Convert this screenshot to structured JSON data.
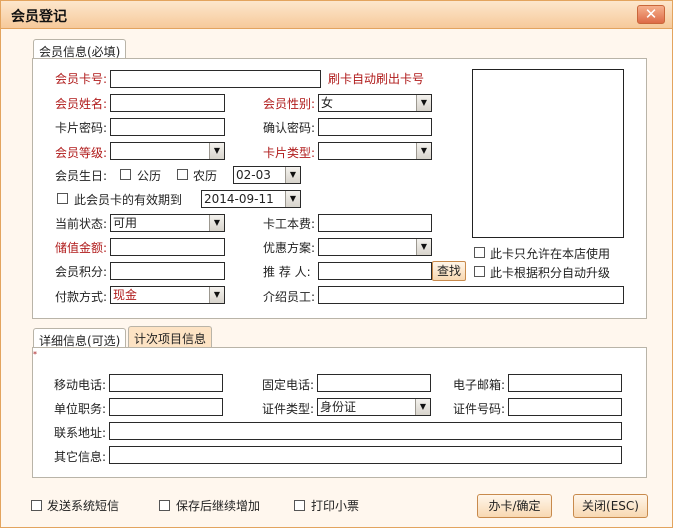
{
  "window": {
    "title": "会员登记",
    "close_icon": "close-icon"
  },
  "tabs": {
    "member_info": "会员信息(必填)",
    "detail": "详细信息(可选)",
    "count_items": "计次项目信息"
  },
  "labels": {
    "card_no": "会员卡号:",
    "name": "会员姓名:",
    "gender": "会员性别:",
    "card_pwd": "卡片密码:",
    "confirm_pwd": "确认密码:",
    "level": "会员等级:",
    "card_type": "卡片类型:",
    "birthday": "会员生日:",
    "solar": "公历",
    "lunar": "农历",
    "validity": "此会员卡的有效期到",
    "status": "当前状态:",
    "card_fee": "卡工本费:",
    "balance": "储值金额:",
    "promo": "优惠方案:",
    "points": "会员积分:",
    "referrer": "推 荐 人:",
    "payment": "付款方式:",
    "introducer": "介绍员工:",
    "store_only": "此卡只允许在本店使用",
    "auto_upgrade": "此卡根据积分自动升级",
    "mobile": "移动电话:",
    "phone": "固定电话:",
    "email": "电子邮箱:",
    "position": "单位职务:",
    "id_type": "证件类型:",
    "id_no": "证件号码:",
    "address": "联系地址:",
    "other": "其它信息:",
    "swipe_hint": "刷卡自动刷出卡号",
    "send_sms": "发送系统短信",
    "continue_add": "保存后继续增加",
    "print_receipt": "打印小票",
    "mark": "*"
  },
  "values": {
    "gender": "女",
    "birthday": "02-03",
    "validity_date": "2014-09-11",
    "status": "可用",
    "payment": "现金",
    "id_type": "身份证"
  },
  "buttons": {
    "search": "查找",
    "confirm": "办卡/确定",
    "close": "关闭(ESC)"
  },
  "colors": {
    "required_label": "#b01b1b",
    "border": "#e3a45e"
  }
}
